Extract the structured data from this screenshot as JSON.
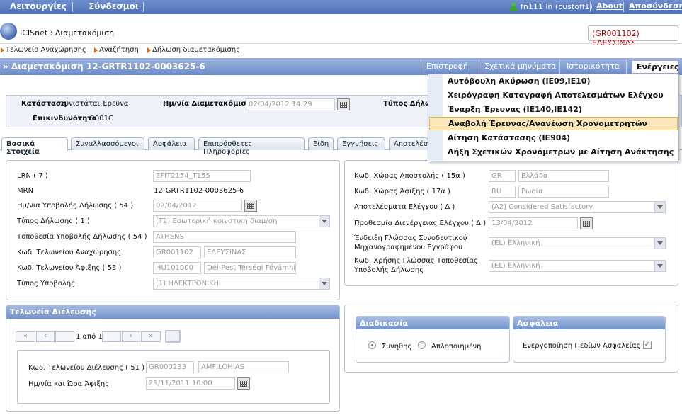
{
  "topbar": {
    "menu1": "Λειτουργίες",
    "menu2": "Σύνδεσμοι",
    "user": "fn111 ln (custoff1)",
    "about": "About",
    "logout": "Αποσύνδεση",
    "user_icon": "user-icon"
  },
  "app": {
    "title": "ICISnet : Διαμετακόμιση",
    "office": "(GR001102) ΕΛΕΥΣΙΝΑΣ"
  },
  "breadcrumb": [
    "Τελωνείο Αναχώρησης",
    "Αναζήτηση",
    "Δήλωση διαμετακόμισης"
  ],
  "header": {
    "title": "» Διαμετακόμιση 12-GRTR1102-0003625-6",
    "btn_return": "Επιστροφή",
    "btn_messages": "Σχετικά μηνύματα",
    "btn_history": "Ιστορικότητα",
    "btn_actions": "Ενέργειες"
  },
  "actions_menu": {
    "items": [
      "Αυτόβουλη Ακύρωση (IE09,IE10)",
      "Χειρόγραφη Καταγραφή Αποτελεσμάτων Ελέγχου",
      "Έναρξη Έρευνας (IE140,IE142)",
      "Αναβολή Έρευνας/Ανανέωση Χρονομετρητών",
      "Αίτηση Κατάστασης (IE904)",
      "Λήξη Σχετικών Χρονόμετρων με Αίτηση Ανάκτησης"
    ],
    "highlighted_index": 3
  },
  "status": {
    "state_label": "Κατάσταση",
    "state_value": "Συνιστάται Έρευνα",
    "date_label": "Ημ/νία Διαμετακόμισης",
    "date_value": "02/04/2012 14:29",
    "type_label": "Τύπος Δήλω",
    "risk_label": "Επικινδυνότητα",
    "risk_value": "O001C"
  },
  "tabs": [
    "Βασικά Στοιχεία",
    "Συναλλασσόμενοι",
    "Ασφάλεια",
    "Επιπρόσθετες Πληροφορίες",
    "Είδη",
    "Εγγυήσεις",
    "Αποτελέσ"
  ],
  "left_form": {
    "lrn_label": "LRN ( 7 )",
    "lrn_value": "EFIT2154_T155",
    "mrn_label": "MRN",
    "mrn_value": "12-GRTR1102-0003625-6",
    "decl_date_label": "Ημ/νια Υποβολής Δήλωσης ( 54 )",
    "decl_date_value": "02/04/2012",
    "decl_type_label": "Τύπος Δήλωσης ( 1 )",
    "decl_type_value": "(T2) Εσωτερική κοινοτική διαμ/ση",
    "place_label": "Τοποθεσία Υποβολής Δήλωσης ( 54 )",
    "place_value": "ATHENS",
    "dep_office_label": "Κωδ. Τελωνείου Αναχώρησης",
    "dep_office_code": "GR001102",
    "dep_office_name": "ΕΛΕΥΣΙΝΑΣ",
    "dest_office_label": "Κωδ. Τελωνείου Άφιξης ( 53 )",
    "dest_office_code": "HU101000",
    "dest_office_name": "Dél-Pest Térségi Fővámhiv",
    "sub_type_label": "Τύπος Υποβολής",
    "sub_type_value": "(1) ΗΛΕΚΤΡΟΝΙΚΗ"
  },
  "right_form": {
    "disp_country_label": "Κωδ. Χώρας Αποστολής ( 15α )",
    "disp_country_code": "GR",
    "disp_country_name": "Ελλάδα",
    "dest_country_label": "Κωδ. Χώρας Άφιξης ( 17α )",
    "dest_country_code": "RU",
    "dest_country_name": "Ρωσία",
    "control_label": "Αποτελέσματα Ελέγχου ( Δ )",
    "control_value": "(A2) Considered Satisfactory",
    "deadline_label": "Προθεσμία Διενέργειας Ελέγχου ( Δ )",
    "deadline_value": "13/04/2012",
    "lang1_label_1": "Ένδειξη Γλώσσας Συνοδευτικού",
    "lang1_label_2": "Μηχανογραφημένου Εγγράφου",
    "lang1_value": "(EL) Ελληνική",
    "lang2_label_1": "Κωδ. Χρήσης Γλώσσας Τοποθεσίας",
    "lang2_label_2": "Υποβολής Δήλωσης",
    "lang2_value": "(EL) Ελληνική"
  },
  "transit": {
    "title": "Τελωνεία Διέλευσης",
    "pager_first": "«",
    "pager_prev": "‹",
    "pager_text": "1 από 1",
    "pager_next": "›",
    "pager_last": "»",
    "office_label": "Κωδ. Τελωνείου Διέλευσης ( 51 )",
    "office_code": "GR000233",
    "office_name": "AMFILOHIAS",
    "arrival_label": "Ημ/νία και Ώρα Άφιξης",
    "arrival_value": "29/11/2011 10:00"
  },
  "procedure": {
    "title": "Διαδικασία",
    "opt_normal": "Συνήθης",
    "opt_simplified": "Απλοποιημένη",
    "selected": "normal"
  },
  "security": {
    "title": "Ασφάλεια",
    "label": "Ενεργοποίηση Πεδίων Ασφαλείας",
    "checked": true
  }
}
